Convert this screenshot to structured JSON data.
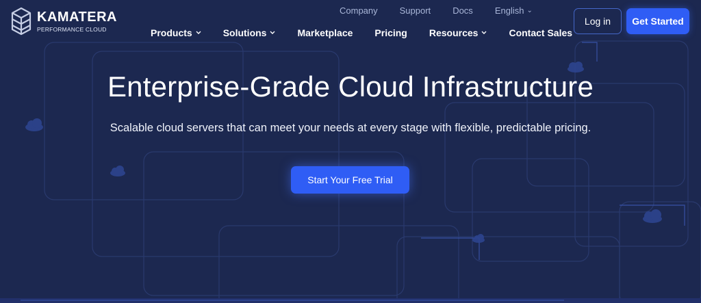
{
  "brand": {
    "name": "KAMATERA",
    "tagline": "PERFORMANCE CLOUD"
  },
  "top_nav": {
    "company": "Company",
    "support": "Support",
    "docs": "Docs",
    "language": "English"
  },
  "main_nav": {
    "products": "Products",
    "solutions": "Solutions",
    "marketplace": "Marketplace",
    "pricing": "Pricing",
    "resources": "Resources",
    "contact_sales": "Contact Sales"
  },
  "header_buttons": {
    "login": "Log in",
    "get_started": "Get Started"
  },
  "hero": {
    "title": "Enterprise-Grade Cloud Infrastructure",
    "subtitle": "Scalable cloud servers that can meet your needs at every stage with flexible, predictable pricing.",
    "cta": "Start Your Free Trial"
  },
  "colors": {
    "background": "#1c2850",
    "accent": "#2f5df5",
    "muted_link": "#a9b6d8"
  },
  "icons": [
    "kamatera-logo-icon",
    "chevron-down-icon",
    "cloud-icon"
  ]
}
